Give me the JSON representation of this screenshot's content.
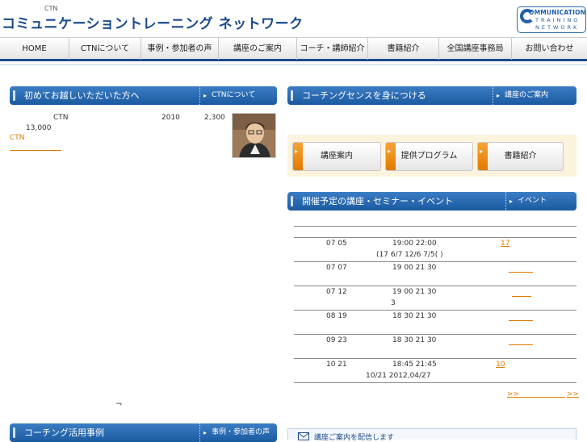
{
  "header": {
    "tagline": "CTN",
    "site_title": "コミュニケーショントレーニング ネットワーク",
    "logo": {
      "line1": "OMMUNICATION",
      "line2": "TRAINING",
      "line3": "NETWORK"
    }
  },
  "nav": {
    "items": [
      "HOME",
      "CTNについて",
      "事例・参加者の声",
      "講座のご案内",
      "コーチ・講師紹介",
      "書籍紹介",
      "全国講座事務局",
      "お問い合わせ"
    ]
  },
  "intro_panel": {
    "title": "初めてお越しいただいた方へ",
    "link": "CTNについて",
    "row1": {
      "a": "CTN",
      "b": "2010",
      "c": "2,300"
    },
    "row2": "13,000",
    "link_text": "CTN"
  },
  "coaching_panel": {
    "title": "コーチングセンスを身につける",
    "link": "講座のご案内"
  },
  "buttons": [
    "講座案内",
    "提供プログラム",
    "書籍紹介"
  ],
  "events_panel": {
    "title": "開催予定の講座・セミナー・イベント",
    "link": "イベント",
    "rows": [
      {
        "date": "07 05",
        "time": "19:00 22:00",
        "link": "17",
        "note": "(17  6/7 12/6  7/5( )"
      },
      {
        "date": "07 07",
        "time": "19 00 21 30",
        "link": "",
        "note": ""
      },
      {
        "date": "07 12",
        "time": "19 00 21 30",
        "link": "",
        "note": "3"
      },
      {
        "date": "08 19",
        "time": "18 30 21 30",
        "link": "",
        "note": ""
      },
      {
        "date": "09 23",
        "time": "18 30 21 30",
        "link": "",
        "note": ""
      },
      {
        "date": "10 21",
        "time": "18:45 21:45",
        "link": "10",
        "note": "10/21 2012,04/27"
      }
    ],
    "more_left": ">>",
    "more_right": ">>"
  },
  "left_mark": "¬",
  "cases_panel": {
    "title": "コーチング活用事例",
    "link": "事例・参加者の声"
  },
  "mail_bar": "講座ご案内を配信します",
  "colors": {
    "accent": "#1a5aa0",
    "link": "#e07a00",
    "button_tab": "#e07a00"
  }
}
